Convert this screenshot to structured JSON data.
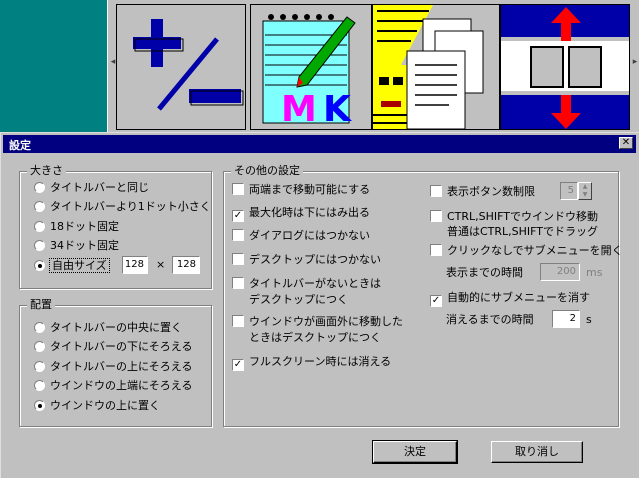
{
  "toolbar": {
    "scroll_left": "◂",
    "scroll_right": "▸",
    "tile_icons": [
      "plus-minus-icon",
      "notepad-mk-icon",
      "pharaoh-documents-icon",
      "resize-vertical-icon"
    ],
    "mk_text": "MK"
  },
  "dialog": {
    "title": "設定",
    "close": "✕",
    "size_group": {
      "label": "大きさ",
      "options": [
        "タイトルバーと同じ",
        "タイトルバーより1ドット小さく",
        "18ドット固定",
        "34ドット固定",
        "自由サイズ"
      ],
      "selected": 4,
      "width_value": "128",
      "times": "×",
      "height_value": "128"
    },
    "placement_group": {
      "label": "配置",
      "options": [
        "タイトルバーの中央に置く",
        "タイトルバーの下にそろえる",
        "タイトルバーの上にそろえる",
        "ウインドウの上端にそろえる",
        "ウインドウの上に置く"
      ],
      "selected": 4
    },
    "other_group": {
      "label": "その他の設定",
      "left_checks": [
        {
          "label": "両端まで移動可能にする",
          "checked": false
        },
        {
          "label": "最大化時は下にはみ出る",
          "checked": true
        },
        {
          "label": "ダイアログにはつかない",
          "checked": false
        },
        {
          "label": "デスクトップにはつかない",
          "checked": false
        },
        {
          "label": "タイトルバーがないときは",
          "label2": "デスクトップにつく",
          "checked": false
        },
        {
          "label": "ウインドウが画面外に移動した",
          "label2": "ときはデスクトップにつく",
          "checked": false
        },
        {
          "label": "フルスクリーン時には消える",
          "checked": true
        }
      ],
      "button_limit": {
        "label": "表示ボタン数制限",
        "checked": false,
        "value": "5"
      },
      "ctrl_shift": {
        "label": "CTRL,SHIFTでウインドウ移動",
        "label2": "普通はCTRL,SHIFTでドラッグ",
        "checked": false
      },
      "no_click_submenu": {
        "label": "クリックなしでサブメニューを開く",
        "checked": false
      },
      "display_time": {
        "label": "表示までの時間",
        "value": "200",
        "unit": "ms"
      },
      "auto_close": {
        "label": "自動的にサブメニューを消す",
        "checked": true
      },
      "close_time": {
        "label": "消えるまでの時間",
        "value": "2",
        "unit": "s"
      }
    },
    "ok_label": "決定",
    "cancel_label": "取り消し"
  },
  "colors": {
    "desktop": "#008080",
    "face": "#c0c0c0",
    "titlebar": "#000080",
    "tile_highlight": "#0000a8"
  }
}
